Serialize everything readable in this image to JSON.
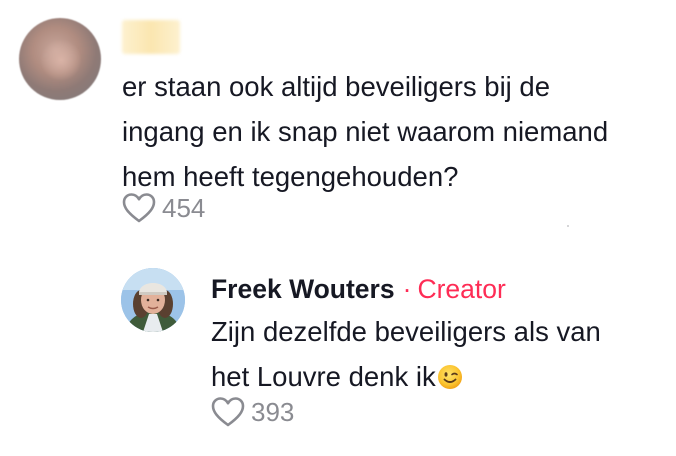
{
  "comment": {
    "username": "",
    "text_lines": [
      "er staan ook altijd beveiligers bij de",
      "ingang en ik snap niet waarom niemand",
      "hem heeft tegengehouden?"
    ],
    "likes": "454",
    "like_icon": "heart-outline-icon",
    "avatar": "blurred-user-avatar"
  },
  "reply": {
    "author": "Freek Wouters",
    "separator": "·",
    "badge": "Creator",
    "text_lines": [
      "Zijn dezelfde beveiligers als van",
      "het Louvre denk ik"
    ],
    "emoji": "winking-face-emoji",
    "likes": "393",
    "like_icon": "heart-outline-icon",
    "avatar": "creator-avatar"
  },
  "colors": {
    "text": "#161823",
    "muted": "#8a8b91",
    "creator_accent": "#fe2c55"
  }
}
